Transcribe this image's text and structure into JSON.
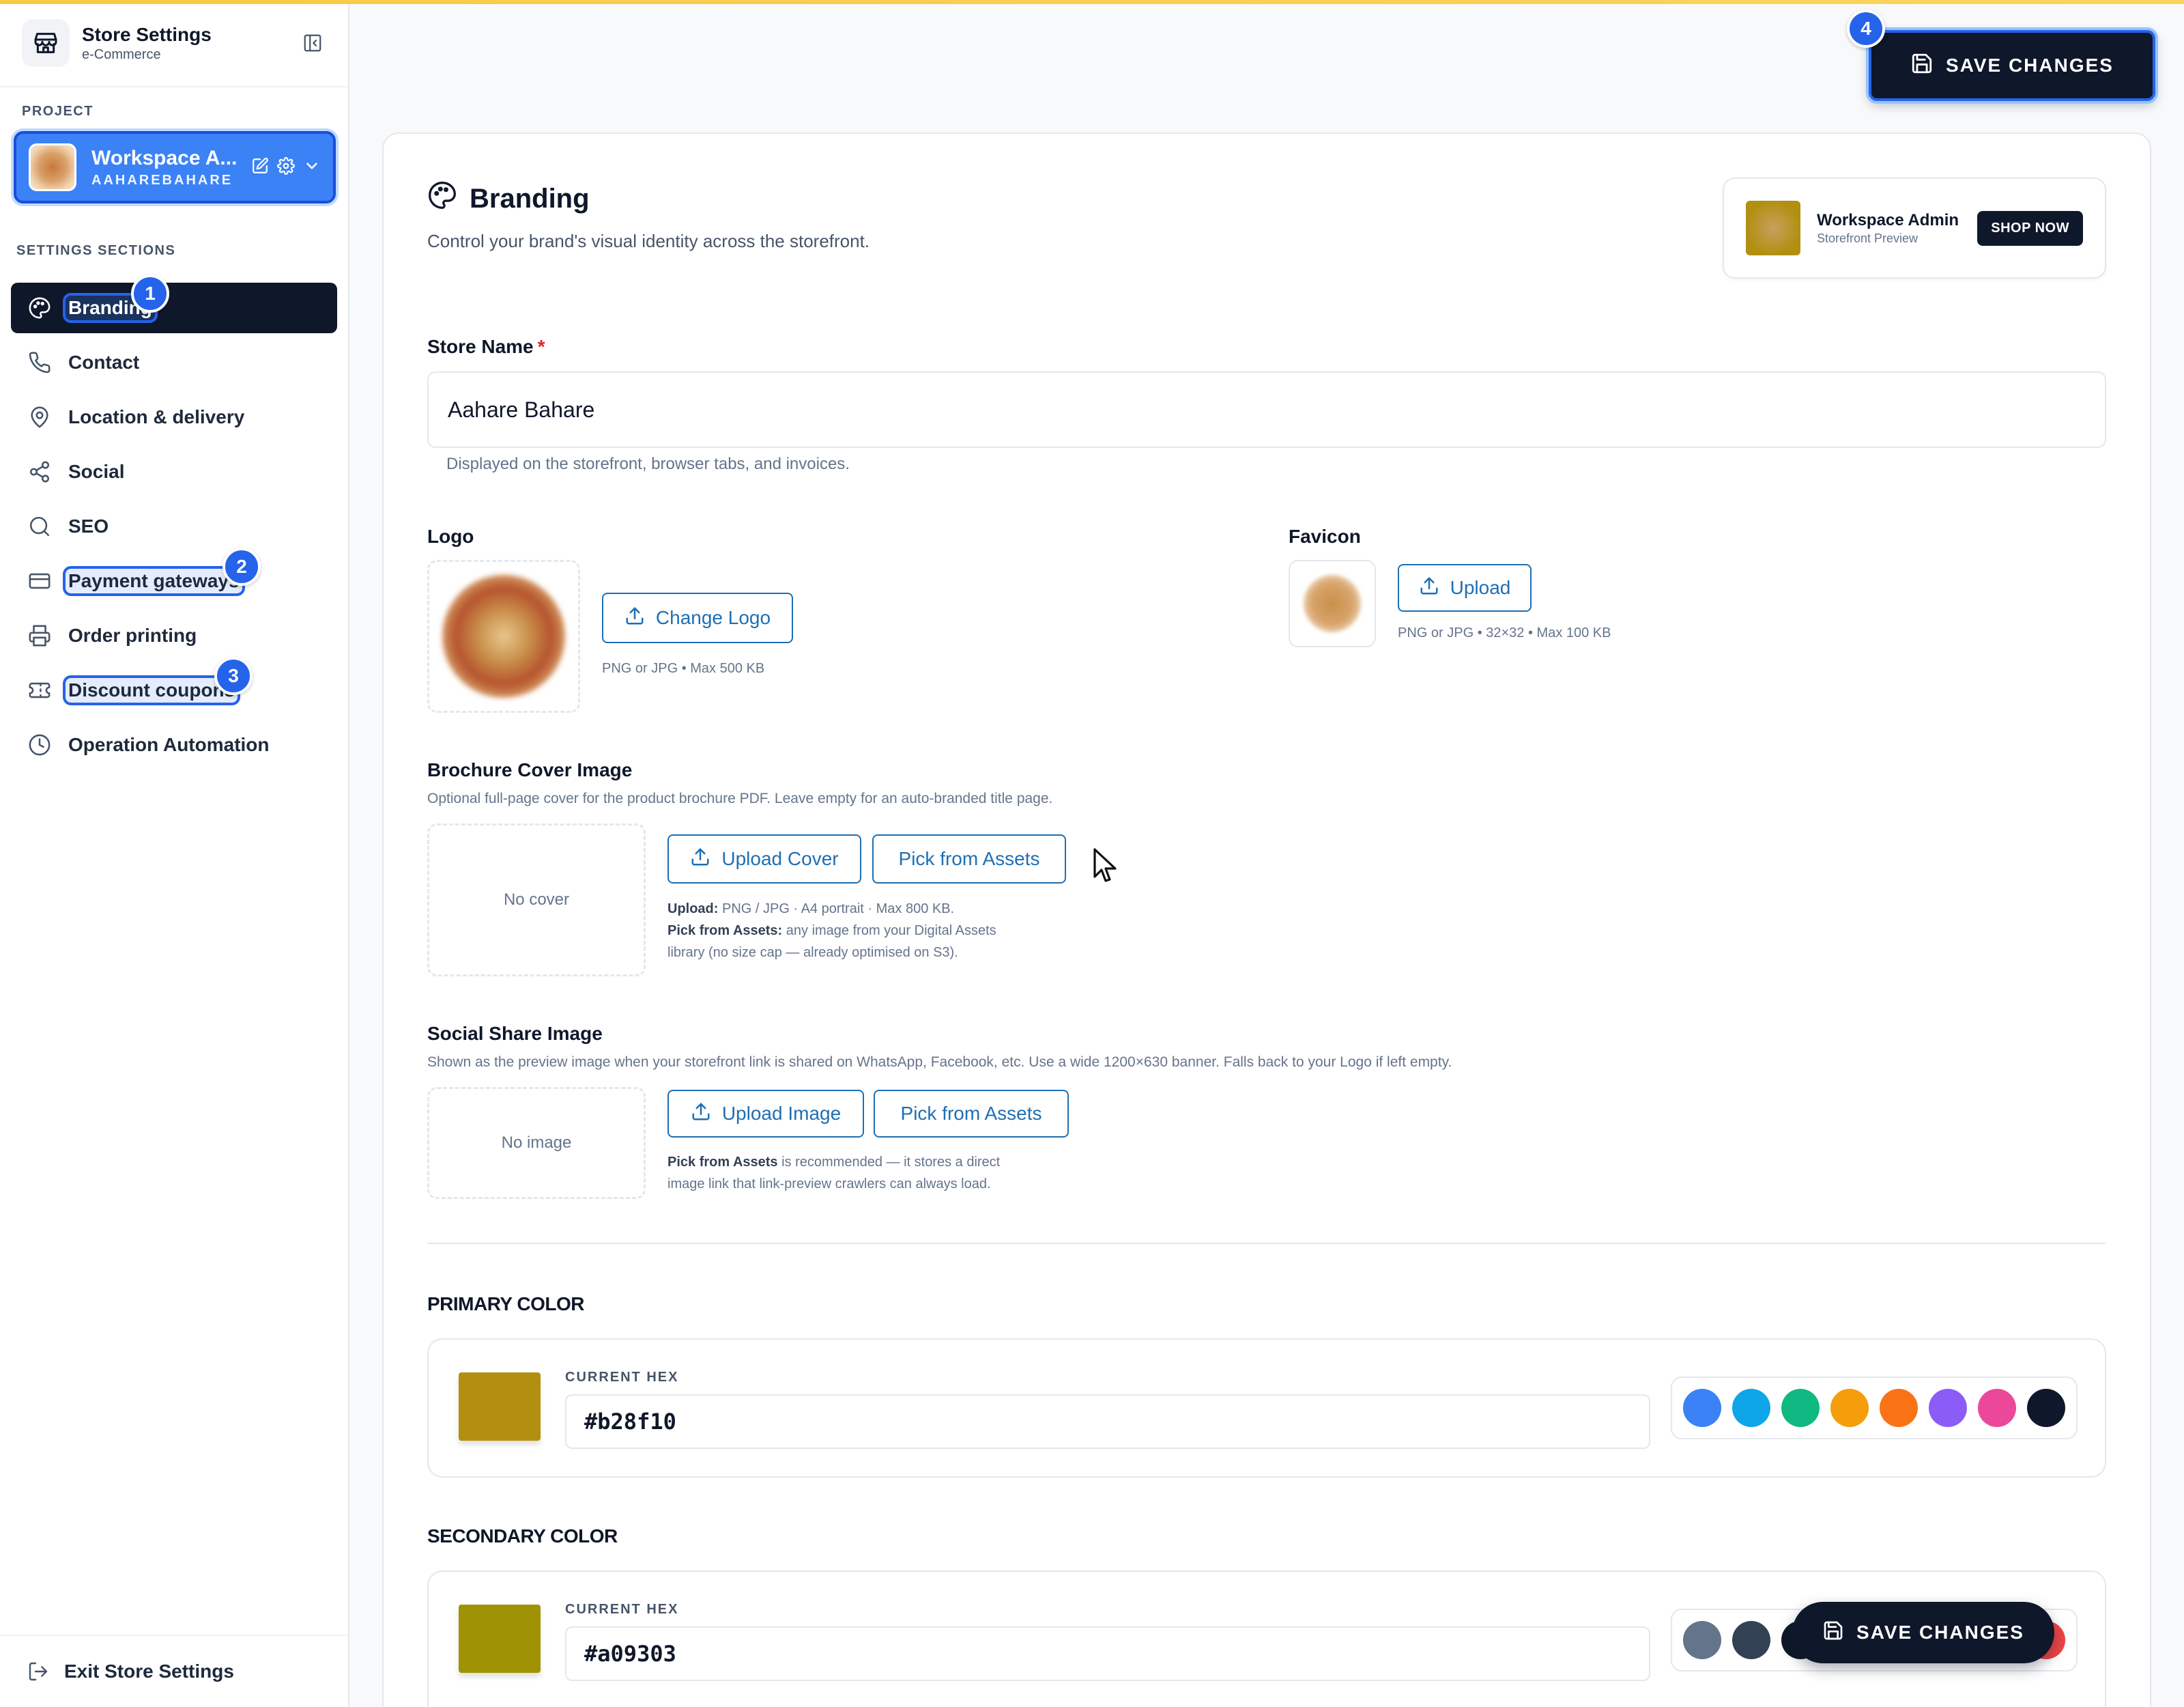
{
  "sidebar": {
    "title": "Store Settings",
    "subtitle": "e-Commerce",
    "project_label": "PROJECT",
    "project": {
      "name": "Workspace A...",
      "slug": "AAHAREBAHARE"
    },
    "sections_label": "SETTINGS SECTIONS",
    "items": [
      {
        "label": "Branding",
        "icon": "palette-icon",
        "active": true,
        "badge": "1"
      },
      {
        "label": "Contact",
        "icon": "phone-icon"
      },
      {
        "label": "Location & delivery",
        "icon": "map-pin-icon"
      },
      {
        "label": "Social",
        "icon": "share-icon"
      },
      {
        "label": "SEO",
        "icon": "search-icon"
      },
      {
        "label": "Payment gateways",
        "icon": "credit-card-icon",
        "badge": "2"
      },
      {
        "label": "Order printing",
        "icon": "printer-icon"
      },
      {
        "label": "Discount coupons",
        "icon": "ticket-icon",
        "badge": "3"
      },
      {
        "label": "Operation Automation",
        "icon": "clock-icon"
      }
    ],
    "exit_label": "Exit Store Settings"
  },
  "header": {
    "save_label": "SAVE CHANGES",
    "save_badge": "4"
  },
  "branding": {
    "title": "Branding",
    "subtitle": "Control your brand's visual identity across the storefront.",
    "preview": {
      "name": "Workspace Admin",
      "caption": "Storefront Preview",
      "cta": "SHOP NOW"
    }
  },
  "store_name": {
    "label": "Store Name",
    "required_mark": "*",
    "value": "Aahare Bahare",
    "helper": "Displayed on the storefront, browser tabs, and invoices."
  },
  "logo": {
    "label": "Logo",
    "button": "Change Logo",
    "hint": "PNG or JPG • Max 500 KB"
  },
  "favicon": {
    "label": "Favicon",
    "button": "Upload",
    "hint": "PNG or JPG • 32×32 • Max 100 KB"
  },
  "brochure": {
    "label": "Brochure Cover Image",
    "description": "Optional full-page cover for the product brochure PDF. Leave empty for an auto-branded title page.",
    "empty": "No cover",
    "upload_button": "Upload Cover",
    "assets_button": "Pick from Assets",
    "note1_bold": "Upload:",
    "note1": " PNG / JPG · A4 portrait · Max 800 KB.",
    "note2_bold": "Pick from Assets:",
    "note2": " any image from your Digital Assets",
    "note3": "library (no size cap — already optimised on S3)."
  },
  "social_share": {
    "label": "Social Share Image",
    "description": "Shown as the preview image when your storefront link is shared on WhatsApp, Facebook, etc. Use a wide 1200×630 banner. Falls back to your Logo if left empty.",
    "empty": "No image",
    "upload_button": "Upload Image",
    "assets_button": "Pick from Assets",
    "note1_bold": "Pick from Assets",
    "note1": " is recommended — it stores a direct",
    "note2": "image link that link-preview crawlers can always load."
  },
  "primary_color": {
    "title": "PRIMARY COLOR",
    "hex_label": "CURRENT HEX",
    "hex": "#b28f10",
    "presets": [
      "#3b82f6",
      "#0ea5e9",
      "#10b981",
      "#f59e0b",
      "#f97316",
      "#8b5cf6",
      "#ec4899",
      "#0f172a"
    ]
  },
  "secondary_color": {
    "title": "SECONDARY COLOR",
    "hex_label": "CURRENT HEX",
    "hex": "#a09303",
    "presets": [
      "#64748b",
      "#334155",
      "#0f172a",
      "#ef4444"
    ]
  },
  "floating_save_label": "SAVE CHANGES"
}
